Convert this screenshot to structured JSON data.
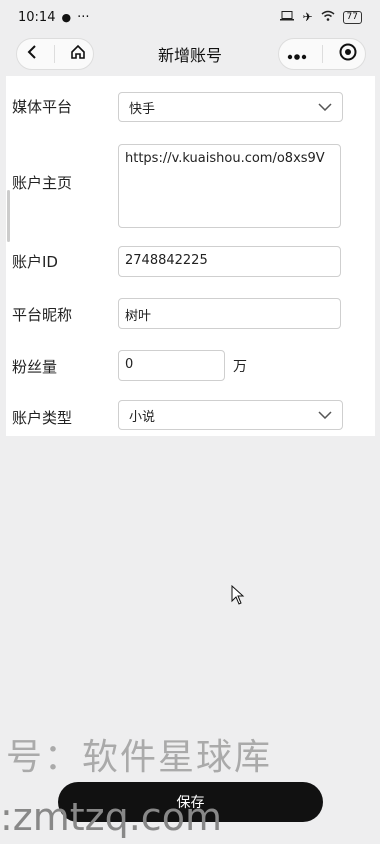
{
  "status_bar": {
    "time": "10:14",
    "dots": "···",
    "battery": "77"
  },
  "nav": {
    "title": "新增账号"
  },
  "form": {
    "platform": {
      "label": "媒体平台",
      "value": "快手"
    },
    "homepage": {
      "label": "账户主页",
      "value": "https://v.kuaishou.com/o8xs9V"
    },
    "account_id": {
      "label": "账户ID",
      "value": "2748842225"
    },
    "nickname": {
      "label": "平台昵称",
      "value": "树叶"
    },
    "followers": {
      "label": "粉丝量",
      "value": "0",
      "unit": "万"
    },
    "account_type": {
      "label": "账户类型",
      "value": "小说"
    }
  },
  "watermark": {
    "line1": "号：软件星球库",
    "line2": ":zmtzq.com"
  },
  "save_label": "保存"
}
